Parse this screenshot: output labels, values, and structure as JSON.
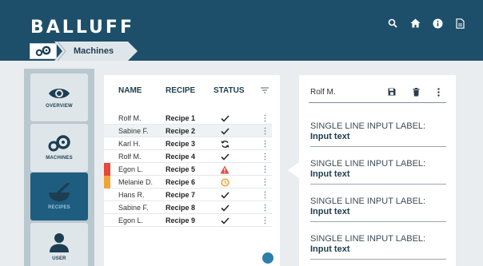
{
  "header": {
    "logo": "BALLUFF",
    "breadcrumb": "Machines"
  },
  "nav": {
    "items": [
      {
        "label": "OVERVIEW"
      },
      {
        "label": "MACHINES"
      },
      {
        "label": "RECIPES"
      },
      {
        "label": "USER"
      }
    ]
  },
  "table": {
    "headers": {
      "name": "NAME",
      "recipe": "RECIPE",
      "status": "STATUS"
    },
    "rows": [
      {
        "name": "Rolf M.",
        "recipe": "Recipe 1",
        "status": "check"
      },
      {
        "name": "Sabine F.",
        "recipe": "Recipe 2",
        "status": "check"
      },
      {
        "name": "Karl H.",
        "recipe": "Recipe 3",
        "status": "sync"
      },
      {
        "name": "Rolf M.",
        "recipe": "Recipe 4",
        "status": "check"
      },
      {
        "name": "Egon L.",
        "recipe": "Recipe 5",
        "status": "error"
      },
      {
        "name": "Melanie D.",
        "recipe": "Recipe 6",
        "status": "pending"
      },
      {
        "name": "Hans R.",
        "recipe": "Recipe 7",
        "status": "check"
      },
      {
        "name": "Sabine F.",
        "recipe": "Recipe 8",
        "status": "check"
      },
      {
        "name": "Egon L.",
        "recipe": "Recipe 9",
        "status": "check"
      }
    ]
  },
  "detail": {
    "name": "Rolf M.",
    "fields": [
      {
        "label": "SINGLE LINE INPUT LABEL:",
        "value": "Input text"
      },
      {
        "label": "SINGLE LINE INPUT LABEL:",
        "value": "Input text"
      },
      {
        "label": "SINGLE LINE INPUT LABEL:",
        "value": "Input text"
      },
      {
        "label": "SINGLE LINE INPUT LABEL:",
        "value": "Input text"
      }
    ]
  },
  "colors": {
    "header": "#1d4f6b",
    "accent": "#1e5d80",
    "error": "#e8473b",
    "warning": "#f2a33a"
  }
}
